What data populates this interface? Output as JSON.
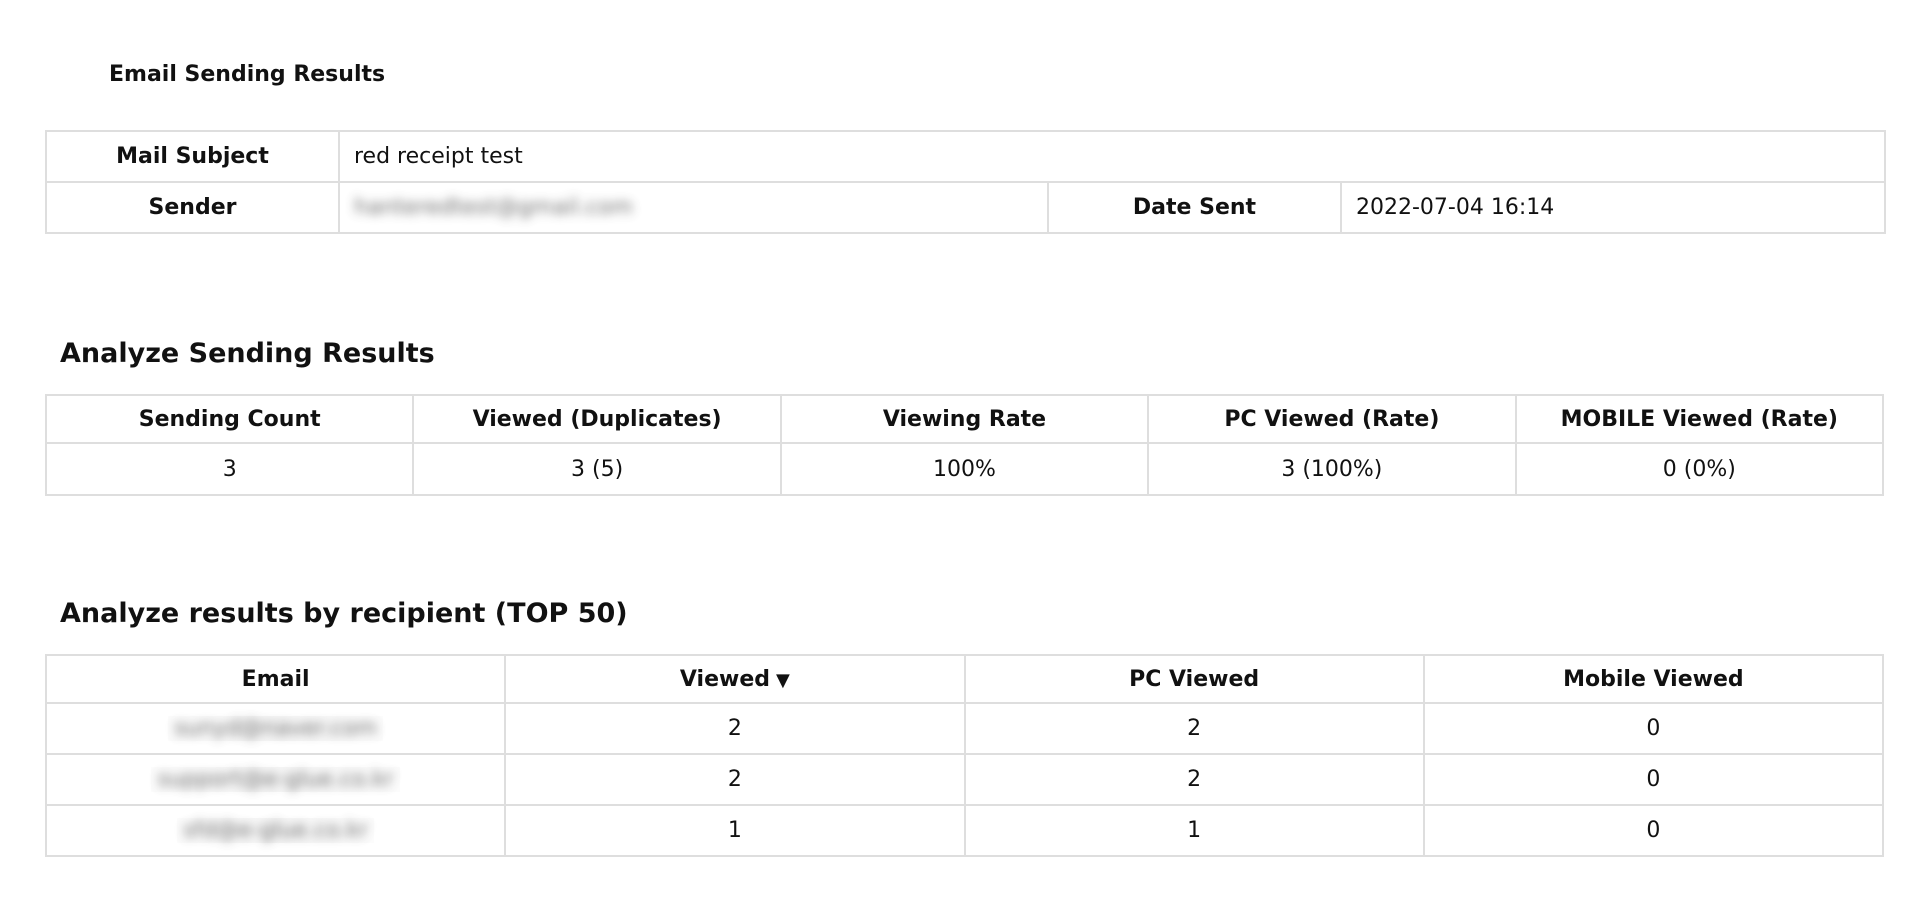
{
  "page": {
    "title": "Email Sending Results"
  },
  "mail_info": {
    "subject_label": "Mail Subject",
    "subject_value": "red receipt test",
    "sender_label": "Sender",
    "sender_value": "hanteredtest@gmail.com",
    "date_label": "Date Sent",
    "date_value": "2022-07-04 16:14"
  },
  "summary": {
    "title": "Analyze Sending Results",
    "headers": [
      "Sending Count",
      "Viewed (Duplicates)",
      "Viewing Rate",
      "PC Viewed (Rate)",
      "MOBILE Viewed (Rate)"
    ],
    "values": [
      "3",
      "3 (5)",
      "100%",
      "3 (100%)",
      "0 (0%)"
    ]
  },
  "recipients": {
    "title": "Analyze results by recipient (TOP 50)",
    "headers": {
      "email": "Email",
      "viewed": "Viewed",
      "viewed_sort_icon": "▼",
      "pc": "PC Viewed",
      "mobile": "Mobile Viewed"
    },
    "rows": [
      {
        "email": "sunyd@naver.com",
        "viewed": "2",
        "pc": "2",
        "mobile": "0"
      },
      {
        "email": "support@e-glue.co.kr",
        "viewed": "2",
        "pc": "2",
        "mobile": "0"
      },
      {
        "email": "sfd@e-glue.co.kr",
        "viewed": "1",
        "pc": "1",
        "mobile": "0"
      }
    ]
  }
}
